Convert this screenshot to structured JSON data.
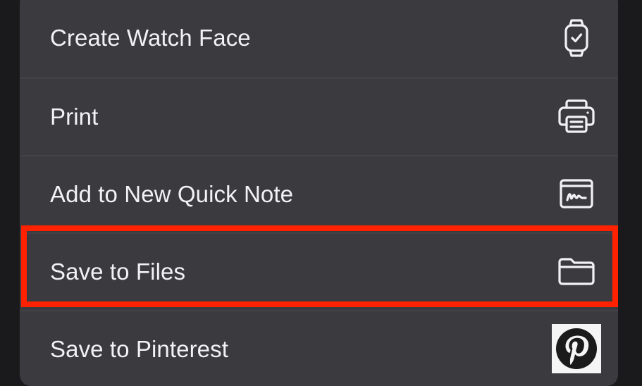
{
  "menu": {
    "items": [
      {
        "label": "Create Watch Face",
        "icon": "watch-icon"
      },
      {
        "label": "Print",
        "icon": "printer-icon"
      },
      {
        "label": "Add to New Quick Note",
        "icon": "quick-note-icon"
      },
      {
        "label": "Save to Files",
        "icon": "folder-icon",
        "highlighted": true
      },
      {
        "label": "Save to Pinterest",
        "icon": "pinterest-icon"
      }
    ]
  },
  "colors": {
    "sheet": "#3b3a3f",
    "text": "#f2f2f4",
    "highlight": "#ff2200",
    "background": "#1a1a1c"
  }
}
